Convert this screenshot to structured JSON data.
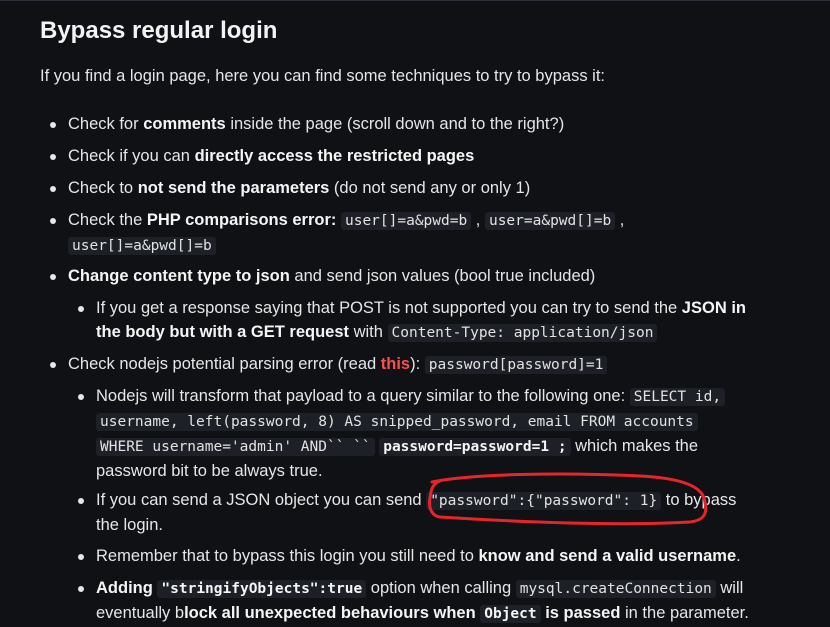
{
  "title": "Bypass regular login",
  "intro": "If you find a login page, here you can find some techniques to try to bypass it:",
  "items": {
    "i1": {
      "a": "Check for ",
      "b": "comments",
      "c": " inside the page (scroll down and to the right?)"
    },
    "i2": {
      "a": "Check if you can ",
      "b": "directly access the restricted pages"
    },
    "i3": {
      "a": "Check to ",
      "b": "not send the parameters",
      "c": " (do not send any or only 1)"
    },
    "i4": {
      "a": "Check the ",
      "b": "PHP comparisons error:",
      "code1": "user[]=a&pwd=b",
      "sep1": " , ",
      "code2": "user=a&pwd[]=b",
      "sep2": " , ",
      "code3": "user[]=a&pwd[]=b"
    },
    "i5": {
      "b": "Change content type to json",
      "c": " and send json values (bool true included)"
    },
    "i5a": {
      "a": "If you get a response saying that POST is not supported you can try to send the ",
      "b1": "JSON in",
      "b2": "the body but with a GET request",
      "c": " with ",
      "code": "Content-Type: application/json"
    },
    "i6": {
      "a": "Check nodejs potential parsing error (read ",
      "link": "this",
      "c": "): ",
      "code": "password[password]=1"
    },
    "i6a": {
      "a": "Nodejs will transform that payload to a query similar to the following one: ",
      "code1": "SELECT id,",
      "code2": "username, left(password, 8) AS snipped_password, email FROM accounts",
      "code3": "WHERE username='admin' AND`` ``",
      "bcode": "password=password=1 ;",
      "c": " which makes the",
      "d": "password bit to be always true."
    },
    "i6b": {
      "a": "If you can send a JSON object you can send ",
      "code": "\"password\":{\"password\": 1}",
      "c": " to bypass",
      "d": "the login."
    },
    "i6c": {
      "a": "Remember that to bypass this login you still need to ",
      "b": "know and send a valid username",
      "c": "."
    },
    "i6d": {
      "b1": "Adding ",
      "bcode1": "\"stringifyObjects\":true",
      "c": " option when calling ",
      "code": "mysql.createConnection",
      "d": " will",
      "e": "eventually b",
      "b2": "lock all unexpected behaviours when ",
      "bcode2": "Object",
      "b3": " is passed",
      "f": " in the parameter."
    }
  },
  "colors": {
    "background": "#0f1115",
    "text": "#e6e6e6",
    "link": "#ff4d4d",
    "annotation": "#e8242b",
    "code_bg": "#1d2027"
  }
}
